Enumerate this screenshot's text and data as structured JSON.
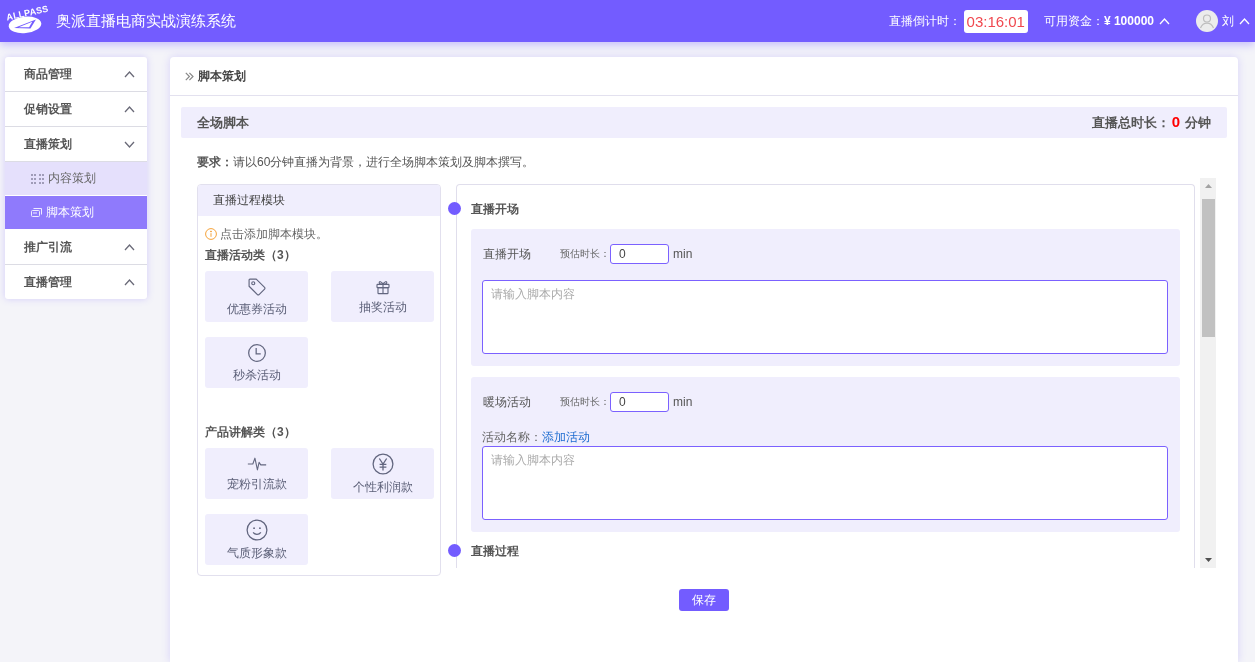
{
  "header": {
    "logo_text": "ALLPASS",
    "title": "奥派直播电商实战演练系统",
    "countdown_label": "直播倒计时：",
    "countdown": "03:16:01",
    "funds_label": "可用资金：",
    "funds": "¥ 100000",
    "user": "刘"
  },
  "sidebar": {
    "items": [
      {
        "label": "商品管理",
        "expanded": false
      },
      {
        "label": "促销设置",
        "expanded": false
      },
      {
        "label": "直播策划",
        "expanded": true,
        "children": [
          {
            "label": "内容策划",
            "selected": false
          },
          {
            "label": "脚本策划",
            "selected": true
          }
        ]
      },
      {
        "label": "推广引流",
        "expanded": false
      },
      {
        "label": "直播管理",
        "expanded": false
      }
    ]
  },
  "breadcrumb": "脚本策划",
  "section": {
    "title": "全场脚本",
    "total_label": "直播总时长：",
    "total": "0",
    "total_unit": "分钟"
  },
  "requirement": "**要求：**请以60分钟直播为背景，进行全场脚本策划及脚本撰写。",
  "modules": {
    "title": "直播过程模块",
    "hint": "点击添加脚本模块。",
    "groups": [
      {
        "title": "直播活动类（3）",
        "tiles": [
          {
            "label": "优惠券活动",
            "kind": "coupon"
          },
          {
            "label": "抽奖活动",
            "kind": "lottery"
          },
          {
            "label": "秒杀活动",
            "kind": "flash-sale"
          }
        ]
      },
      {
        "title": "产品讲解类（3）",
        "tiles": [
          {
            "label": "宠粉引流款",
            "kind": "traffic"
          },
          {
            "label": "个性利润款",
            "kind": "profit"
          },
          {
            "label": "气质形象款",
            "kind": "image"
          }
        ]
      }
    ]
  },
  "script": {
    "stages": [
      {
        "title": "直播开场",
        "blocks": [
          {
            "title": "直播开场",
            "duration_label": "预估时长：",
            "duration": "0",
            "unit": "min",
            "placeholder": "请输入脚本内容"
          },
          {
            "title": "暖场活动",
            "duration_label": "预估时长：",
            "duration": "0",
            "unit": "min",
            "activity_label": "活动名称：",
            "activity_link": "添加活动",
            "placeholder": "请输入脚本内容"
          }
        ]
      },
      {
        "title": "直播过程"
      }
    ]
  },
  "save_button": "保存"
}
